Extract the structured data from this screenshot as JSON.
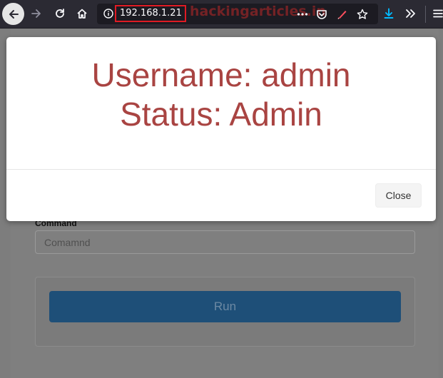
{
  "browser": {
    "url": "192.168.1.21",
    "watermark": "hackingarticles.in"
  },
  "modal": {
    "line1": "Username: admin",
    "line2": "Status: Admin",
    "close_label": "Close"
  },
  "form": {
    "command_label": "Command",
    "command_placeholder": "Comamnd",
    "run_label": "Run"
  },
  "colors": {
    "toolbar_bg": "#2b2a33",
    "modal_text": "#a94442",
    "run_button": "#1e4f78",
    "url_highlight": "#e01b24"
  },
  "icons": {
    "back": "arrow-left-icon",
    "forward": "arrow-right-icon",
    "reload": "reload-icon",
    "home": "home-icon",
    "info": "info-icon",
    "more": "more-horizontal-icon",
    "pocket": "pocket-icon",
    "pen": "pen-icon",
    "star": "star-icon",
    "download": "download-icon",
    "overflow": "chevron-double-right-icon",
    "menu": "hamburger-menu-icon"
  }
}
